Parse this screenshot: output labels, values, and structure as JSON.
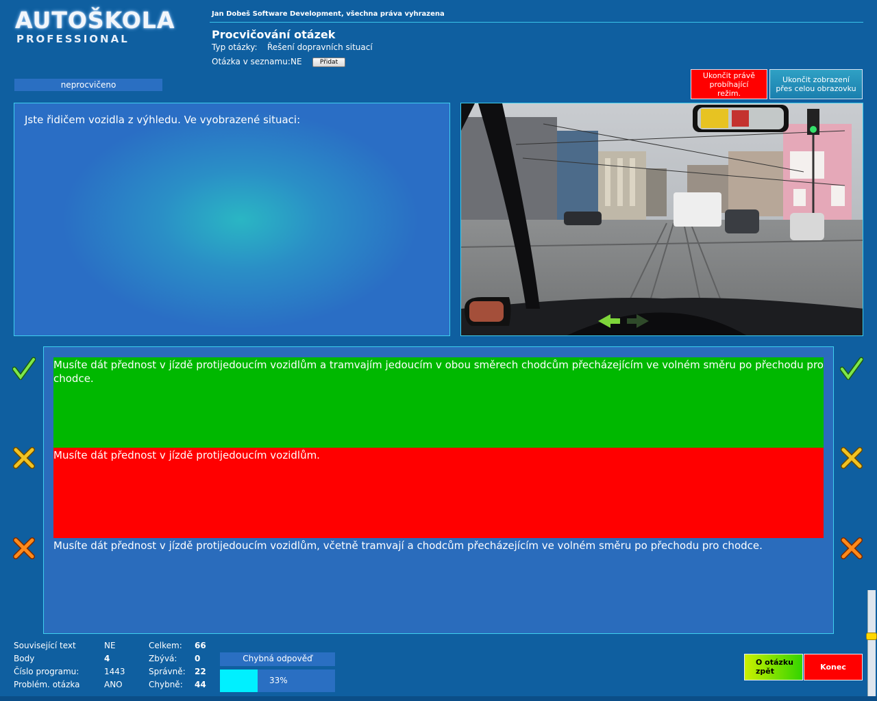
{
  "app": {
    "logo_main": "AUTOŠKOLA",
    "logo_sub": "PROFESSIONAL",
    "copyright": "Jan Dobeš Software Development, všechna práva vyhrazena"
  },
  "header": {
    "title": "Procvičování otázek",
    "type_label": "Typ otázky:",
    "type_value": "Řešení dopravních situací",
    "list_label": "Otázka v seznamu:",
    "list_value": "NE",
    "add_button": "Přidat"
  },
  "status": "neprocvičeno",
  "top_buttons": {
    "end_mode": "Ukončit právě probíhající režim.",
    "end_fullscreen": "Ukončit zobrazení přes celou obrazovku"
  },
  "question": {
    "text": "Jste řidičem vozidla z výhledu. Ve vyobrazené situaci:"
  },
  "answers": [
    {
      "text": "Musíte dát přednost v jízdě protijedoucím vozidlům a tramvajím jedoucím v obou směrech chodcům přecházejícím ve volném směru po přechodu pro chodce.",
      "state": "correct",
      "color": "#00b800",
      "mark": "check-icon"
    },
    {
      "text": "Musíte dát přednost v jízdě protijedoucím vozidlům.",
      "state": "wrong-selected",
      "color": "#ff0000",
      "mark": "cross-yellow-icon"
    },
    {
      "text": "Musíte dát přednost v jízdě protijedoucím vozidlům, včetně tramvají a chodcům přecházejícím ve volném směru po přechodu pro chodce.",
      "state": "wrong",
      "color": "#2a6cbc",
      "mark": "cross-orange-icon"
    }
  ],
  "stats": {
    "related_text_label": "Související text",
    "related_text_value": "NE",
    "points_label": "Body",
    "points_value": "4",
    "program_label": "Číslo programu:",
    "program_value": "1443",
    "problem_label": "Problém. otázka",
    "problem_value": "ANO",
    "total_label": "Celkem:",
    "total_value": "66",
    "remaining_label": "Zbývá:",
    "remaining_value": "0",
    "correct_label": "Správně:",
    "correct_value": "22",
    "wrong_label": "Chybně:",
    "wrong_value": "44"
  },
  "result": {
    "label": "Chybná odpověď",
    "progress_text": "33%",
    "progress_value": 0.33,
    "progress_color": "#00f0ff"
  },
  "bottom_buttons": {
    "back": "O otázku zpět",
    "end": "Konec"
  }
}
